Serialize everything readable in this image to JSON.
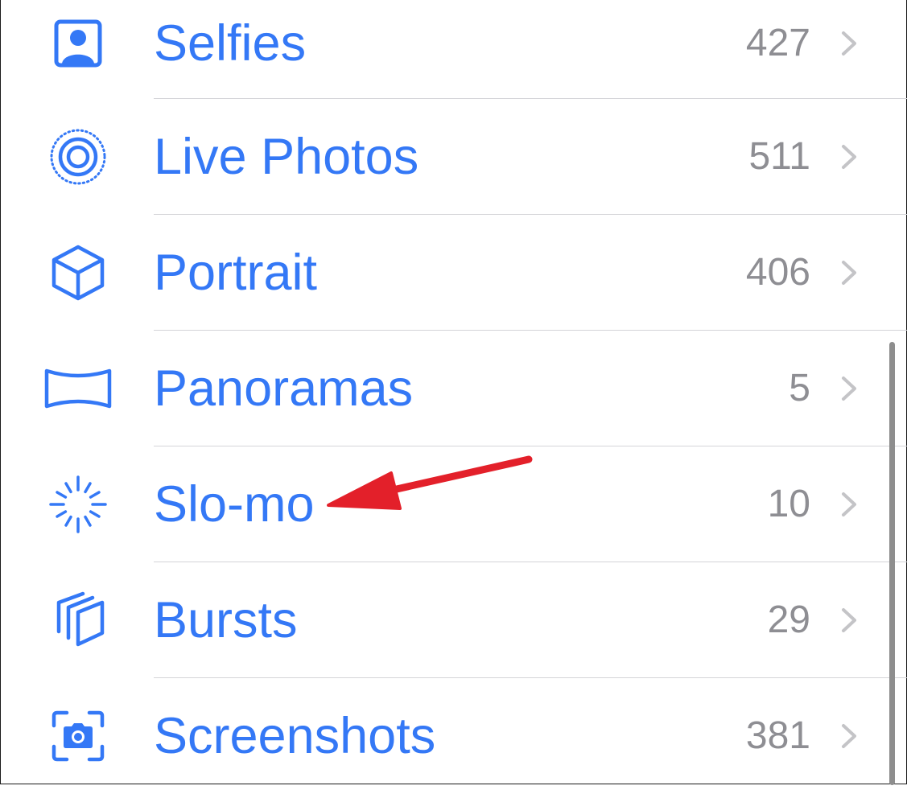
{
  "albums": [
    {
      "key": "selfies",
      "label": "Selfies",
      "count": "427",
      "icon": "person-square-icon"
    },
    {
      "key": "live-photos",
      "label": "Live Photos",
      "count": "511",
      "icon": "live-photo-icon"
    },
    {
      "key": "portrait",
      "label": "Portrait",
      "count": "406",
      "icon": "cube-icon"
    },
    {
      "key": "panoramas",
      "label": "Panoramas",
      "count": "5",
      "icon": "panorama-icon"
    },
    {
      "key": "slo-mo",
      "label": "Slo-mo",
      "count": "10",
      "icon": "slowmo-icon"
    },
    {
      "key": "bursts",
      "label": "Bursts",
      "count": "29",
      "icon": "bursts-icon"
    },
    {
      "key": "screenshots",
      "label": "Screenshots",
      "count": "381",
      "icon": "screenshot-icon"
    }
  ],
  "colors": {
    "accent": "#3478f6",
    "count": "#8e8e93",
    "chevron": "#c4c4c7",
    "separator": "#d4d4d8",
    "annotation_arrow": "#e3202a"
  },
  "annotation": {
    "type": "arrow",
    "points_to": "Slo-mo"
  }
}
